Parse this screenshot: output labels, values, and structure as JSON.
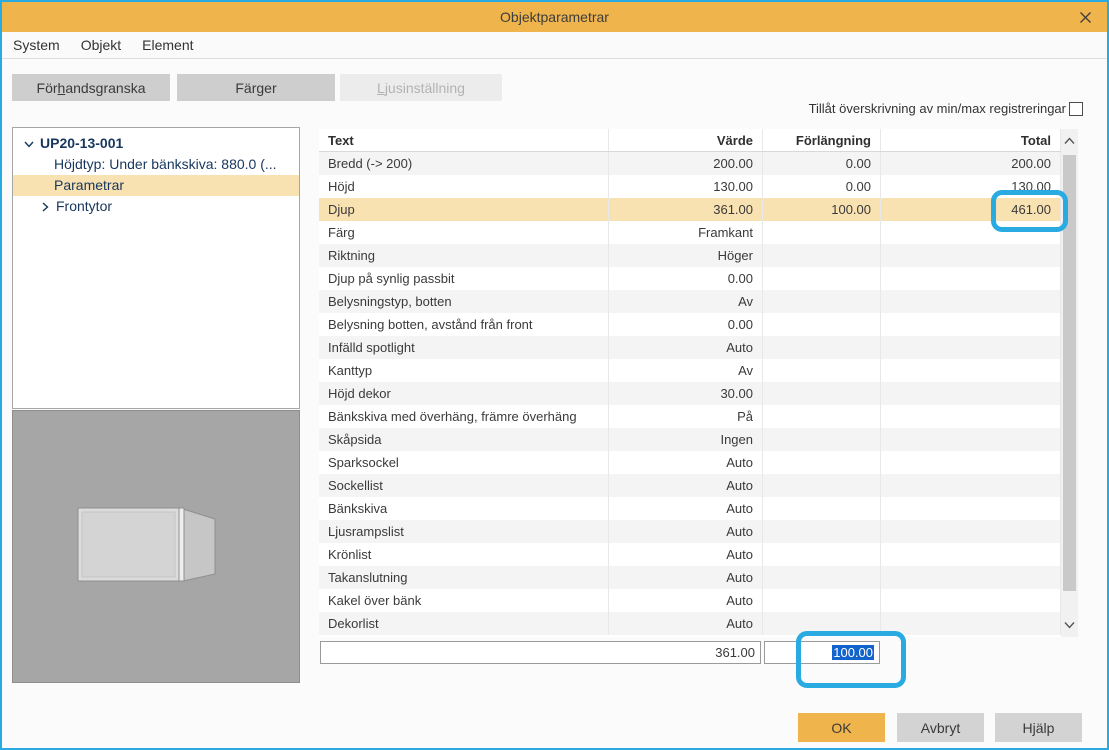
{
  "colors": {
    "titlebar": "#efb44c",
    "window_border": "#29abe2",
    "annotation": "#29abe2",
    "row_selected": "#f9e2b2",
    "ok_button": "#efb44c",
    "text_selection": "#1263cb",
    "tree_text": "#17365d"
  },
  "window": {
    "title": "Objektparametrar"
  },
  "menu": {
    "items": [
      "System",
      "Objekt",
      "Element"
    ]
  },
  "toolbar": {
    "preview": {
      "pre": "För",
      "key": "h",
      "post": "andsgranska"
    },
    "colors": {
      "pre": "Fär",
      "key": "g",
      "post": "er"
    },
    "light": {
      "pre": "",
      "key": "L",
      "post": "jusinställning"
    }
  },
  "override": {
    "label": "Tillåt överskrivning av min/max registreringar",
    "checked": false
  },
  "tree": {
    "root": "UP20-13-001",
    "height_type": "Höjdtyp: Under bänkskiva:  880.0 (...",
    "parameters": "Parametrar",
    "fronts": "Frontytor"
  },
  "table": {
    "headers": {
      "text": "Text",
      "value": "Värde",
      "extension": "Förlängning",
      "total": "Total"
    },
    "rows": [
      {
        "text": "Bredd (-> 200)",
        "value": "200.00",
        "extension": "0.00",
        "total": "200.00"
      },
      {
        "text": "Höjd",
        "value": "130.00",
        "extension": "0.00",
        "total": "130.00"
      },
      {
        "text": "Djup",
        "value": "361.00",
        "extension": "100.00",
        "total": "461.00",
        "selected": true
      },
      {
        "text": "Färg",
        "value": "Framkant",
        "extension": "",
        "total": ""
      },
      {
        "text": "Riktning",
        "value": "Höger",
        "extension": "",
        "total": ""
      },
      {
        "text": "Djup på synlig passbit",
        "value": "0.00",
        "extension": "",
        "total": ""
      },
      {
        "text": "Belysningstyp, botten",
        "value": "Av",
        "extension": "",
        "total": ""
      },
      {
        "text": "Belysning botten, avstånd från front",
        "value": "0.00",
        "extension": "",
        "total": ""
      },
      {
        "text": "Infälld spotlight",
        "value": "Auto",
        "extension": "",
        "total": ""
      },
      {
        "text": "Kanttyp",
        "value": "Av",
        "extension": "",
        "total": ""
      },
      {
        "text": "Höjd dekor",
        "value": "30.00",
        "extension": "",
        "total": ""
      },
      {
        "text": "Bänkskiva med överhäng, främre överhäng",
        "value": "På",
        "extension": "",
        "total": ""
      },
      {
        "text": "Skåpsida",
        "value": "Ingen",
        "extension": "",
        "total": ""
      },
      {
        "text": "Sparksockel",
        "value": "Auto",
        "extension": "",
        "total": ""
      },
      {
        "text": "Sockellist",
        "value": "Auto",
        "extension": "",
        "total": ""
      },
      {
        "text": "Bänkskiva",
        "value": "Auto",
        "extension": "",
        "total": ""
      },
      {
        "text": "Ljusrampslist",
        "value": "Auto",
        "extension": "",
        "total": ""
      },
      {
        "text": "Krönlist",
        "value": "Auto",
        "extension": "",
        "total": ""
      },
      {
        "text": "Takanslutning",
        "value": "Auto",
        "extension": "",
        "total": ""
      },
      {
        "text": "Kakel över bänk",
        "value": "Auto",
        "extension": "",
        "total": ""
      },
      {
        "text": "Dekorlist",
        "value": "Auto",
        "extension": "",
        "total": ""
      }
    ]
  },
  "editor": {
    "value_field": "361.00",
    "extension_field": "100.00"
  },
  "footer": {
    "ok": "OK",
    "cancel": "Avbryt",
    "help": "Hjälp"
  }
}
